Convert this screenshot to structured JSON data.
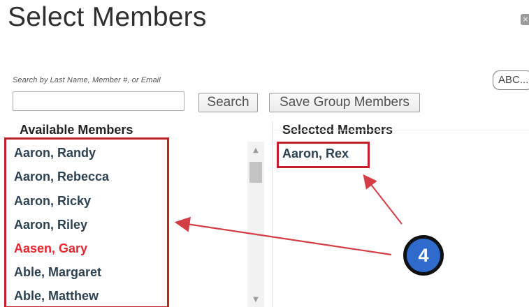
{
  "dialog": {
    "title": "Select Members",
    "close_label": "×"
  },
  "search": {
    "label": "Search by Last Name, Member #, or Email",
    "value": "",
    "placeholder": ""
  },
  "toolbar": {
    "search_label": "Search",
    "save_label": "Save Group Members",
    "abc_label": "ABC..."
  },
  "available": {
    "heading": "Available Members",
    "items": [
      "Aaron, Randy",
      "Aaron, Rebecca",
      "Aaron, Ricky",
      "Aaron, Riley",
      "Aasen, Gary",
      "Able, Margaret",
      "Able, Matthew"
    ],
    "highlighted_item": "Aasen, Gary"
  },
  "selected": {
    "heading": "Selected Members",
    "items": [
      "Aaron, Rex"
    ]
  },
  "annotation": {
    "step_number": "4"
  },
  "icons": {
    "close": "close-icon",
    "scroll_up": "scroll-up-icon",
    "scroll_down": "scroll-down-icon"
  },
  "colors": {
    "accent_red": "#C21F28",
    "highlight_red": "#E3272F",
    "member_text": "#2D4250",
    "step_blue": "#2F6BCB"
  }
}
